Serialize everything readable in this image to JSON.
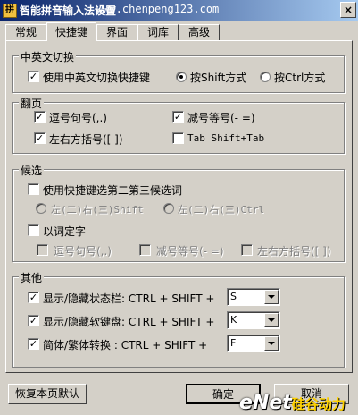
{
  "window": {
    "title": "智能拼音输入法设置",
    "watermark": "www.chenpeng123.com",
    "close_glyph": "×"
  },
  "tabs": [
    {
      "label": "常规"
    },
    {
      "label": "快捷键"
    },
    {
      "label": "界面"
    },
    {
      "label": "词库"
    },
    {
      "label": "高级"
    }
  ],
  "switch_group": {
    "title": "中英文切换",
    "use_switch_label": "使用中英文切换快捷键",
    "shift_label": "按Shift方式",
    "ctrl_label": "按Ctrl方式",
    "selected": "shift"
  },
  "page_group": {
    "title": "翻页",
    "comma_period": "逗号句号(,.)",
    "minus_equal": "减号等号(- =)",
    "brackets": "左右方括号([ ])",
    "tab_shift_tab": "Tab Shift+Tab"
  },
  "candidate_group": {
    "title": "候选",
    "use_shortcut_label": "使用快捷键选第二第三候选词",
    "lr_shift": "左(二)右(三)Shift",
    "lr_ctrl": "左(二)右(三)Ctrl",
    "word_to_char": "以词定字",
    "wc_comma_period": "逗号句号(,.)",
    "wc_minus_equal": "减号等号(- =)",
    "wc_brackets": "左右方括号([ ])"
  },
  "other_group": {
    "title": "其他",
    "rows": [
      {
        "label": "显示/隐藏状态栏: CTRL + SHIFT +",
        "key": "S"
      },
      {
        "label": "显示/隐藏软键盘: CTRL + SHIFT +",
        "key": "K"
      },
      {
        "label": "简体/繁体转换   : CTRL + SHIFT +",
        "key": "F"
      }
    ]
  },
  "buttons": {
    "restore_defaults": "恢复本页默认",
    "ok": "确定",
    "cancel": "取消"
  },
  "logo": {
    "text": "eNet",
    "sub": "硅谷动力"
  },
  "check_glyph": "✓"
}
